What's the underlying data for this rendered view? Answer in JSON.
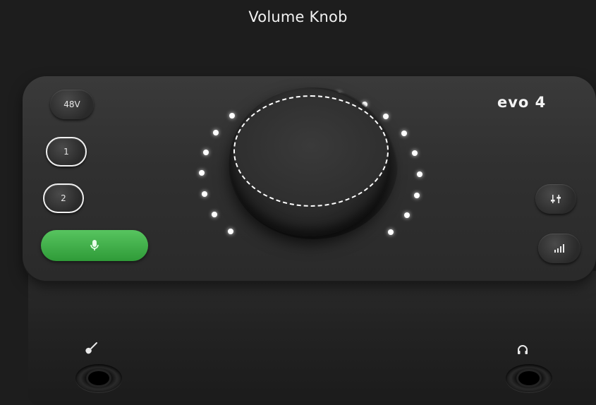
{
  "title": "Volume Knob",
  "device": {
    "logo": "evo 4",
    "buttons": {
      "phantom_label": "48V",
      "ch1_label": "1",
      "ch2_label": "2"
    },
    "icons": {
      "mic": "microphone-icon",
      "mixer": "mixer-sliders-icon",
      "meter": "level-meter-icon",
      "guitar": "guitar-icon",
      "headphones": "headphones-icon"
    },
    "colors": {
      "mic_button": "#3fb24a",
      "leds": "#ffffff",
      "highlight_outline": "#ffffff"
    }
  }
}
